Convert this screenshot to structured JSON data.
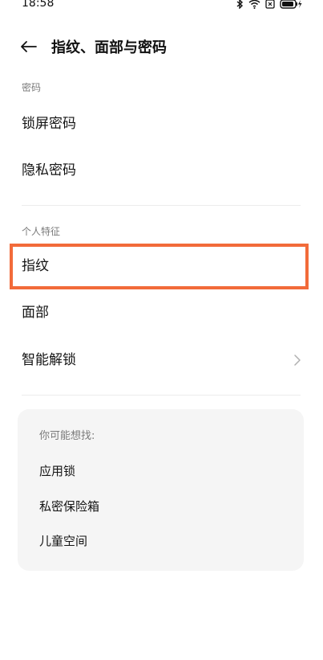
{
  "status_bar": {
    "time": "18:58",
    "icons": [
      "bluetooth-icon",
      "wifi-icon",
      "sim-icon",
      "battery-charging-icon"
    ]
  },
  "header": {
    "back_icon": "arrow-left-icon",
    "title": "指纹、面部与密码"
  },
  "sections": {
    "password": {
      "label": "密码",
      "items": [
        {
          "label": "锁屏密码"
        },
        {
          "label": "隐私密码"
        }
      ]
    },
    "personal": {
      "label": "个人特征",
      "items": [
        {
          "label": "指纹",
          "highlighted": true
        },
        {
          "label": "面部"
        },
        {
          "label": "智能解锁",
          "chevron": "chevron-right-icon"
        }
      ]
    }
  },
  "suggestions": {
    "title": "你可能想找:",
    "items": [
      {
        "label": "应用锁"
      },
      {
        "label": "私密保险箱"
      },
      {
        "label": "儿童空间"
      }
    ]
  },
  "colors": {
    "highlight": "#f26b3a",
    "card_bg": "#f5f5f5",
    "secondary_text": "#7a7a7a"
  }
}
